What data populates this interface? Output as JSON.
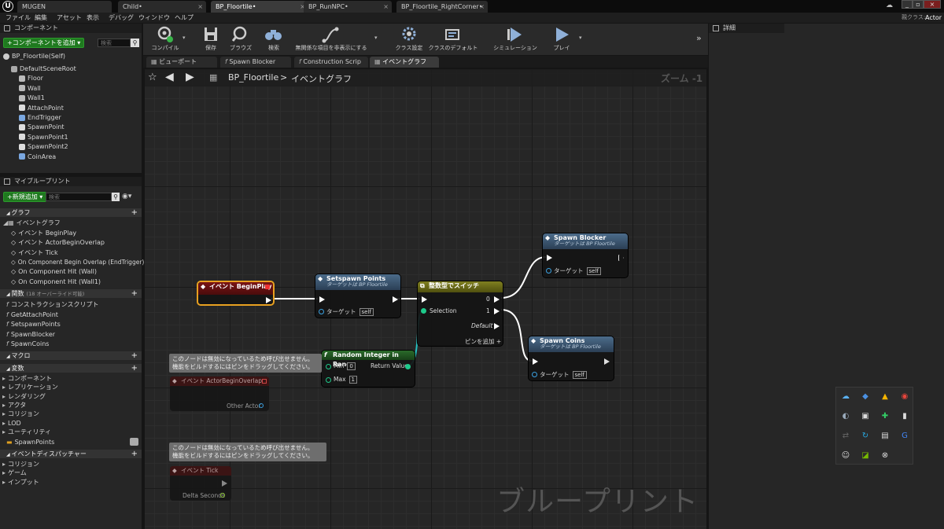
{
  "titlebar": {
    "logo": "U",
    "tabs": [
      {
        "label": "MUGEN"
      },
      {
        "label": "Child•"
      },
      {
        "label": "BP_Floortile•"
      },
      {
        "label": "BP_RunNPC•"
      },
      {
        "label": "BP_Floortile_RightCorner•"
      }
    ],
    "parent_class_label": "親クラス:",
    "parent_class_value": "Actor"
  },
  "menubar": [
    "ファイル",
    "編集",
    "アセット",
    "表示",
    "デバッグ",
    "ウィンドウ",
    "ヘルプ"
  ],
  "components_panel": {
    "title": "コンポーネント",
    "add_button": "+コンポーネントを追加 ▾",
    "search_placeholder": "検索",
    "root_label": "BP_Floortile(Self)",
    "items": [
      "DefaultSceneRoot",
      "Floor",
      "Wall",
      "Wall1",
      "AttachPoint",
      "EndTrigger",
      "SpawnPoint",
      "SpawnPoint1",
      "SpawnPoint2",
      "CoinArea"
    ]
  },
  "my_blueprint": {
    "title": "マイブループリント",
    "add_button": "+新規追加 ▾",
    "search_placeholder": "検索",
    "graph_section": "グラフ",
    "event_graph": "イベントグラフ",
    "events": [
      "イベント BeginPlay",
      "イベント ActorBeginOverlap",
      "イベント Tick",
      "On Component Begin Overlap (EndTrigger)",
      "On Component Hit (Wall)",
      "On Component Hit (Wall1)"
    ],
    "functions_section": "関数",
    "functions_note": "(18 オーバーライド可能)",
    "functions": [
      "コンストラクションスクリプト",
      "GetAttachPoint",
      "SetspawnPoints",
      "SpawnBlocker",
      "SpawnCoins"
    ],
    "macros_section": "マクロ",
    "variables_section": "変数",
    "var_categories": [
      "コンポーネント",
      "レプリケーション",
      "レンダリング",
      "アクタ",
      "コリジョン",
      "LOD",
      "ユーティリティ"
    ],
    "variables": [
      "SpawnPoints"
    ],
    "dispatchers_section": "イベントディスパッチャー",
    "dispatcher_categories": [
      "コリジョン",
      "ゲーム",
      "インプット"
    ]
  },
  "toolbar": {
    "buttons": [
      "コンパイル",
      "保存",
      "ブラウズ",
      "検索",
      "無関係な項目を非表示にする",
      "クラス設定",
      "クラスのデフォルト",
      "シミュレーション",
      "プレイ"
    ]
  },
  "editor_tabs": [
    "ビューポート",
    "Spawn Blocker",
    "Construction Scrip",
    "イベントグラフ"
  ],
  "breadcrumb": {
    "root": "BP_Floortile",
    "sep": ">",
    "current": "イベントグラフ",
    "zoom": "ズーム -1"
  },
  "details_panel": {
    "title": "詳細"
  },
  "graph": {
    "watermark": "ブループリント",
    "target_label": "ターゲット",
    "self_label": "self",
    "nodes": {
      "begin_play": {
        "title": "イベント BeginPlay"
      },
      "setspawn": {
        "title": "Setspawn Points",
        "subtitle": "ターゲットは BP Floortile"
      },
      "switch": {
        "title": "整数型でスイッチ",
        "selection": "Selection",
        "out0": "0",
        "out1": "1",
        "default": "Default",
        "add_pin": "ピンを追加 +"
      },
      "random": {
        "title": "Random Integer in Range",
        "min_label": "Min",
        "min_value": "0",
        "max_label": "Max",
        "max_value": "1",
        "return": "Return Value"
      },
      "spawn_blocker": {
        "title": "Spawn Blocker",
        "subtitle": "ターゲットは BP Floortile"
      },
      "spawn_coins": {
        "title": "Spawn Coins",
        "subtitle": "ターゲットは BP Floortile"
      },
      "overlap": {
        "title": "イベント ActorBeginOverlap",
        "pin": "Other Actor"
      },
      "tick": {
        "title": "イベント Tick",
        "pin": "Delta Seconds"
      }
    },
    "disabled_comment_1": "このノードは無効になっているため呼び出せません。",
    "disabled_comment_2": "機能をビルドするにはピンをドラッグしてください。"
  },
  "tray_icons": [
    "cloud-icon",
    "dropbox-icon",
    "gdrive-icon",
    "chrome-icon",
    "steam-icon",
    "network-icon",
    "app-icon",
    "mic-icon",
    "arrows-icon",
    "refresh-icon",
    "window-icon",
    "google-icon",
    "discord-icon",
    "nvidia-icon",
    "xbox-icon"
  ]
}
